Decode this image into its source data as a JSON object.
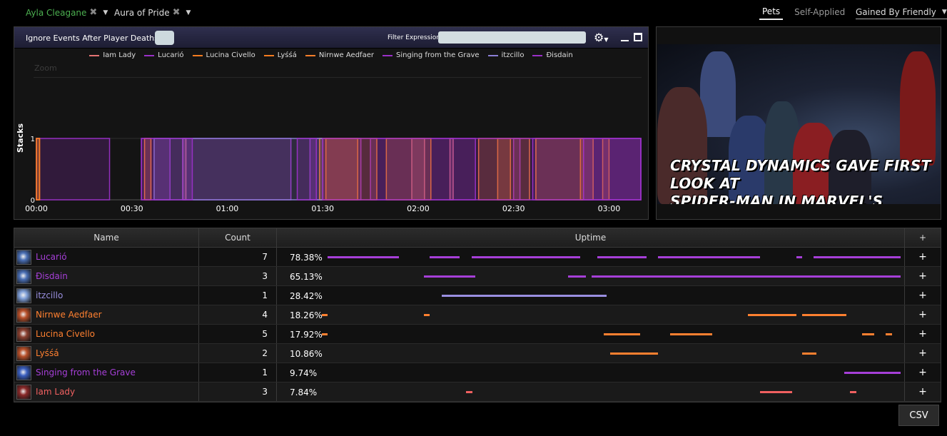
{
  "filters": [
    {
      "label": "Ayla Cleagane",
      "color": "#4caf50"
    },
    {
      "label": "Aura of Pride",
      "color": "#dddddd"
    }
  ],
  "right_tabs": {
    "pets": "Pets",
    "self_applied": "Self-Applied",
    "gained_by": "Gained By Friendly"
  },
  "toolbar": {
    "ignore_events": "Ignore Events After Player Deaths",
    "filter_label": "Filter Expression:",
    "filter_value": ""
  },
  "chart_data": {
    "type": "area",
    "ylabel": "Stacks",
    "zoom_label": "Zoom",
    "ylim": [
      0,
      1
    ],
    "yticks": [
      "0",
      "1"
    ],
    "xticks": [
      {
        "label": "00:00",
        "t": 0
      },
      {
        "label": "00:30",
        "t": 30
      },
      {
        "label": "01:00",
        "t": 60
      },
      {
        "label": "01:30",
        "t": 90
      },
      {
        "label": "02:00",
        "t": 120
      },
      {
        "label": "02:30",
        "t": 150
      },
      {
        "label": "03:00",
        "t": 180
      }
    ],
    "xlim": [
      0,
      190
    ],
    "series": [
      {
        "name": "Iam Lady",
        "color": "#e57373",
        "intervals": [
          [
            46,
            47
          ],
          [
            118,
            122
          ],
          [
            130,
            131
          ]
        ]
      },
      {
        "name": "Lucarió",
        "color": "#9b30c8",
        "intervals": [
          [
            0,
            23
          ],
          [
            33,
            42
          ],
          [
            46,
            80
          ],
          [
            86,
            102
          ],
          [
            105,
            138
          ],
          [
            150,
            152
          ],
          [
            156,
            190
          ]
        ]
      },
      {
        "name": "Lucina Civello",
        "color": "#f57c20",
        "intervals": [
          [
            0,
            1
          ],
          [
            89,
            101
          ],
          [
            110,
            124
          ],
          [
            171,
            175
          ],
          [
            178,
            180
          ]
        ]
      },
      {
        "name": "Lyśśá",
        "color": "#f57c20",
        "intervals": [
          [
            91,
            107
          ],
          [
            145,
            149
          ]
        ]
      },
      {
        "name": "Nirnwe Aedfaer",
        "color": "#ff7f2a",
        "intervals": [
          [
            0,
            1
          ],
          [
            34,
            36
          ],
          [
            139,
            155
          ],
          [
            157,
            172
          ]
        ]
      },
      {
        "name": "Singing from the Grave",
        "color": "#9b30c8",
        "intervals": [
          [
            172,
            190
          ]
        ]
      },
      {
        "name": "itzcillo",
        "color": "#8b7fd6",
        "intervals": [
          [
            37,
            90
          ]
        ]
      },
      {
        "name": "Ðisdain",
        "color": "#9b30c8",
        "intervals": [
          [
            33,
            49
          ],
          [
            82,
            88
          ],
          [
            90,
            190
          ]
        ]
      }
    ]
  },
  "video": {
    "caption_line1": "CRYSTAL DYNAMICS GAVE FIRST LOOK AT",
    "caption_line2": "SPIDER-MAN IN MARVEL'S AVENGERS"
  },
  "table": {
    "headers": {
      "name": "Name",
      "count": "Count",
      "uptime": "Uptime",
      "plus": "+"
    },
    "rows": [
      {
        "name": "Lucarió",
        "color": "#a63fd8",
        "count": "7",
        "uptime": "78.38%",
        "icon": "frost-orb-icon",
        "icon_color": "#4a6fb5"
      },
      {
        "name": "Ðisdain",
        "color": "#a63fd8",
        "count": "3",
        "uptime": "65.13%",
        "icon": "frost-orb-icon",
        "icon_color": "#4a6fb5"
      },
      {
        "name": "itzcillo",
        "color": "#9a8fe0",
        "count": "1",
        "uptime": "28.42%",
        "icon": "holy-light-icon",
        "icon_color": "#7f9fd8"
      },
      {
        "name": "Nirnwe Aedfaer",
        "color": "#ff8030",
        "count": "4",
        "uptime": "18.26%",
        "icon": "fire-swirl-icon",
        "icon_color": "#b8502a"
      },
      {
        "name": "Lucina Civello",
        "color": "#ff8030",
        "count": "5",
        "uptime": "17.92%",
        "icon": "rage-icon",
        "icon_color": "#8a4030"
      },
      {
        "name": "Lyśśá",
        "color": "#ff8030",
        "count": "2",
        "uptime": "10.86%",
        "icon": "fire-swirl-icon",
        "icon_color": "#b8502a"
      },
      {
        "name": "Singing from the Grave",
        "color": "#a63fd8",
        "count": "1",
        "uptime": "9.74%",
        "icon": "arcane-rune-icon",
        "icon_color": "#3a5fc0"
      },
      {
        "name": "Iam Lady",
        "color": "#f06060",
        "count": "3",
        "uptime": "7.84%",
        "icon": "blood-strike-icon",
        "icon_color": "#8a2a2a"
      }
    ],
    "csv": "CSV"
  }
}
